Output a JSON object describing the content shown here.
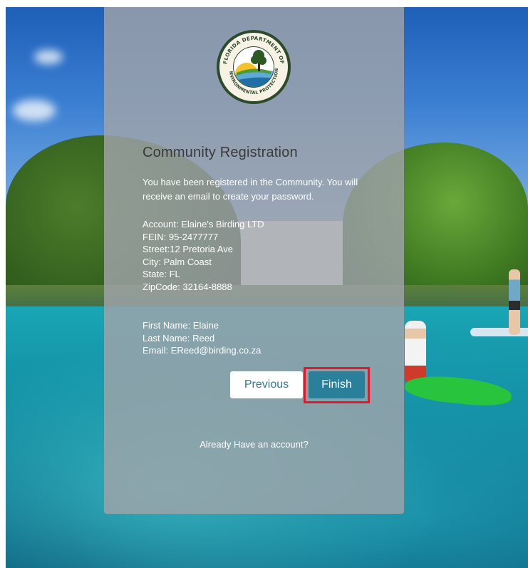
{
  "logo": {
    "text_top": "FLORIDA DEPARTMENT OF",
    "text_bottom": "ENVIRONMENTAL PROTECTION",
    "icon": "fdep-seal-icon"
  },
  "form": {
    "title": "Community Registration",
    "message": "You have been registered in the Community. You will receive an email to create your password."
  },
  "account": {
    "account": "Account: Elaine's Birding LTD",
    "fein": "FEIN: 95-2477777",
    "street": "Street:12 Pretoria Ave",
    "city": "City: Palm Coast",
    "state": "State: FL",
    "zip": "ZipCode: 32164-8888"
  },
  "contact": {
    "first_name": "First Name: Elaine",
    "last_name": "Last Name: Reed",
    "email": "Email: EReed@birding.co.za"
  },
  "buttons": {
    "previous": "Previous",
    "finish": "Finish"
  },
  "footer": {
    "login_link": "Already Have an account?"
  },
  "colors": {
    "accent": "#2a7f9b",
    "highlight": "#e2182c",
    "panel": "#a0a4aa"
  }
}
